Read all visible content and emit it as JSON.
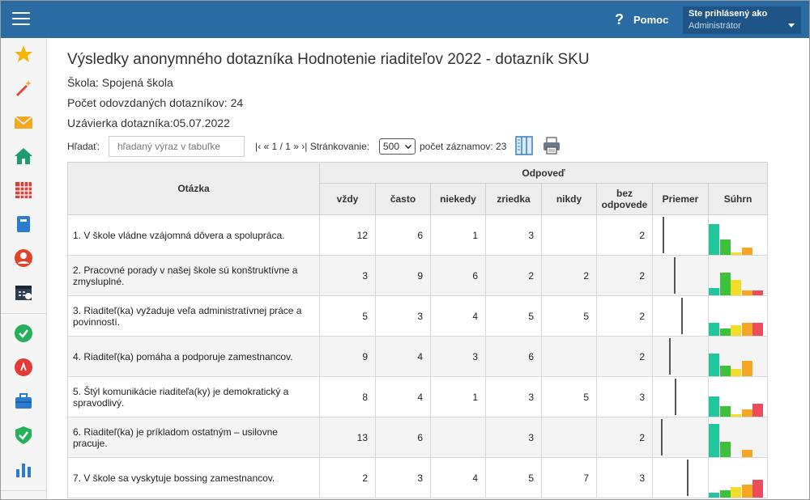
{
  "header": {
    "help_label": "Pomoc",
    "help_icon": "question-icon",
    "user_line1": "Ste prihlásený ako",
    "user_line2": "Administrátor"
  },
  "sidebar": {
    "items": [
      {
        "icon": "star-icon",
        "color": "#f2b705"
      },
      {
        "icon": "magic-wand-icon",
        "color": "#e8473b"
      },
      {
        "icon": "envelope-icon",
        "color": "#f5a623"
      },
      {
        "icon": "home-icon",
        "color": "#1e9b6f"
      },
      {
        "icon": "grid-calendar-icon",
        "color": "#d9433b"
      },
      {
        "icon": "notebook-icon",
        "color": "#2b7bd1"
      },
      {
        "icon": "user-circle-icon",
        "color": "#e0452c"
      },
      {
        "icon": "clock-calendar-icon",
        "color": "#2c3e50"
      },
      {
        "icon": "check-badge-icon",
        "color": "#27b05a"
      },
      {
        "icon": "pin-badge-icon",
        "color": "#e53935"
      },
      {
        "icon": "briefcase-icon",
        "color": "#2b7bd1"
      },
      {
        "icon": "shield-check-icon",
        "color": "#27b05a"
      },
      {
        "icon": "bar-chart-icon",
        "color": "#2b7bd1"
      }
    ]
  },
  "page": {
    "title": "Výsledky anonymného dotazníka Hodnotenie riaditeľov 2022 - dotazník SKU",
    "school": "Škola: Spojená škola",
    "submitted": "Počet odovzdaných dotazníkov: 24",
    "deadline": "Uzávierka dotazníka:05.07.2022"
  },
  "toolbar": {
    "search_label": "Hľadať:",
    "search_placeholder": "hľadaný výraz v tabuľke",
    "pager_first": "|‹",
    "pager_prev": "«",
    "pager_pages": "1 / 1",
    "pager_next": "»",
    "pager_last": "›|",
    "paging_label": "Stránkovanie:",
    "paging_value": "500",
    "count_label": "počet záznamov: 23",
    "columns_icon": "columns-icon",
    "print_icon": "printer-icon"
  },
  "table": {
    "question_header": "Otázka",
    "answer_group_header": "Odpoveď",
    "answer_headers": [
      "vždy",
      "často",
      "niekedy",
      "zriedka",
      "nikdy",
      "bez odpovede"
    ],
    "avg_header": "Priemer",
    "sum_header": "Súhrn",
    "spark_colors": [
      "#1fc79a",
      "#3ec13a",
      "#f2dd2b",
      "#f5a623",
      "#ee4b5b"
    ],
    "rows": [
      {
        "question": "1. V škole vládne vzájomná dôvera a spolupráca.",
        "values": [
          "12",
          "6",
          "1",
          "3",
          "",
          "2"
        ],
        "avg_fraction": 0.17
      },
      {
        "question": "2. Pracovné porady v našej škole sú konštruktívne a zmysluplné.",
        "values": [
          "3",
          "9",
          "6",
          "2",
          "2",
          "2"
        ],
        "avg_fraction": 0.38
      },
      {
        "question": "3. Riaditeľ(ka) vyžaduje veľa administratívnej práce a povinností.",
        "values": [
          "5",
          "3",
          "4",
          "5",
          "5",
          "2"
        ],
        "avg_fraction": 0.52
      },
      {
        "question": "4. Riaditeľ(ka) pomáha a podporuje zamestnancov.",
        "values": [
          "9",
          "4",
          "3",
          "6",
          "",
          "2"
        ],
        "avg_fraction": 0.3
      },
      {
        "question": "5. Štýl komunikácie riaditeľa(ky) je demokratický a spravodlivý.",
        "values": [
          "8",
          "4",
          "1",
          "3",
          "5",
          "3"
        ],
        "avg_fraction": 0.4
      },
      {
        "question": "6. Riaditeľ(ka) je príkladom ostatným – usilovne pracuje.",
        "values": [
          "13",
          "6",
          "",
          "3",
          "",
          "2"
        ],
        "avg_fraction": 0.15
      },
      {
        "question": "7. V škole sa vyskytuje bossing zamestnancov.",
        "values": [
          "2",
          "3",
          "4",
          "5",
          "7",
          "3"
        ],
        "avg_fraction": 0.62
      }
    ]
  }
}
